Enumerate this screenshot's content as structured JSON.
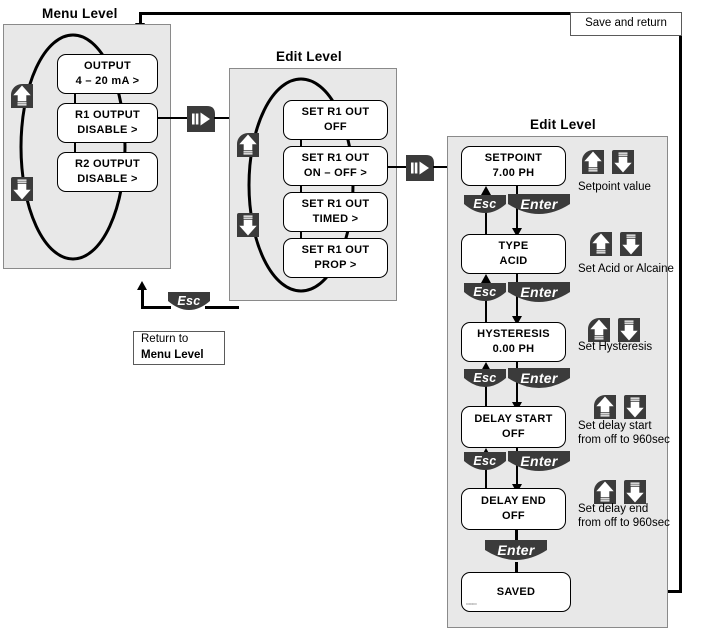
{
  "diagram": {
    "title_menu_level": "Menu Level",
    "title_edit_level_1": "Edit Level",
    "title_edit_level_2": "Edit Level"
  },
  "menu_level": {
    "title": "Menu Level",
    "items": [
      {
        "line1": "OUTPUT",
        "line2": "4 – 20 mA      >"
      },
      {
        "line1": "R1   OUTPUT",
        "line2": "DISABLE      >"
      },
      {
        "line1": "R2   OUTPUT",
        "line2": "DISABLE      >"
      }
    ],
    "up_key": "up-arrow-key",
    "down_key": "down-arrow-key"
  },
  "edit_level_1": {
    "title": "Edit Level",
    "items": [
      {
        "line1": "SET   R1   OUT",
        "line2": "OFF"
      },
      {
        "line1": "SET   R1   OUT",
        "line2": "ON – OFF   >"
      },
      {
        "line1": "SET   R1   OUT",
        "line2": "TIMED      >"
      },
      {
        "line1": "SET   R1   OUT",
        "line2": "PROP      >"
      }
    ],
    "up_key": "up-arrow-key",
    "down_key": "down-arrow-key"
  },
  "edit_level_2": {
    "title": "Edit Level",
    "steps": [
      {
        "line1": "SETPOINT",
        "line2": "7.00  PH",
        "note_line1": "Setpoint value",
        "note_line2": "",
        "esc": "Esc",
        "enter": "Enter"
      },
      {
        "line1": "TYPE",
        "line2": "ACID",
        "note_line1": "Set Acid or Alcaine",
        "note_line2": "",
        "esc": "Esc",
        "enter": "Enter"
      },
      {
        "line1": "HYSTERESIS",
        "line2": "0.00  PH",
        "note_line1": "Set Hysteresis",
        "note_line2": "",
        "esc": "Esc",
        "enter": "Enter"
      },
      {
        "line1": "DELAY  START",
        "line2": "OFF",
        "note_line1": "Set delay start",
        "note_line2": "from off to 960sec",
        "esc": "Esc",
        "enter": "Enter"
      },
      {
        "line1": "DELAY  END",
        "line2": "OFF",
        "note_line1": "Set delay end",
        "note_line2": "from off to 960sec",
        "esc": "Esc",
        "enter": "Enter"
      }
    ],
    "final_enter": "Enter",
    "saved": {
      "line1": "SAVED",
      "line2": ""
    }
  },
  "callouts": {
    "save_and_return": "Save and return",
    "return_to_line1": "Return to",
    "return_to_line2": "Menu Level",
    "esc_return": "Esc",
    "nav_right_1": "right-arrow-key",
    "nav_right_2": "right-arrow-key"
  },
  "colors": {
    "panel_fill": "#e8e8e8",
    "panel_border": "#8a8a8a",
    "key_dark": "#3b3b3b",
    "line": "#000000",
    "lcd_fill": "#ffffff"
  }
}
